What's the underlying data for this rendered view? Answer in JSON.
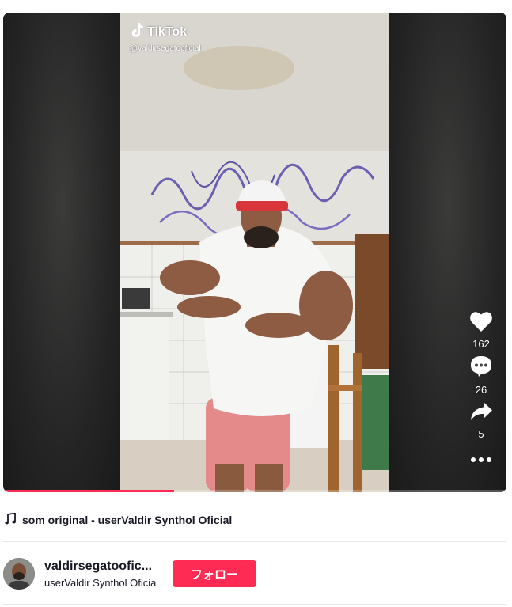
{
  "video": {
    "watermark_brand": "TikTok",
    "watermark_handle": "@valdirsegatooficial",
    "progress": 0.34,
    "accent_color": "#fe2c55"
  },
  "actions": {
    "likes": "162",
    "comments": "26",
    "shares": "5",
    "like_icon": "heart-icon",
    "comment_icon": "comment-bubble-icon",
    "share_icon": "share-arrow-icon",
    "more_icon": "ellipsis-icon"
  },
  "music": {
    "icon": "music-note-icon",
    "title": "som original - userValdir Synthol Oficial"
  },
  "author": {
    "handle": "valdirsegatoofic...",
    "nickname": "userValdir Synthol Oficia",
    "follow_label": "フォロー"
  }
}
